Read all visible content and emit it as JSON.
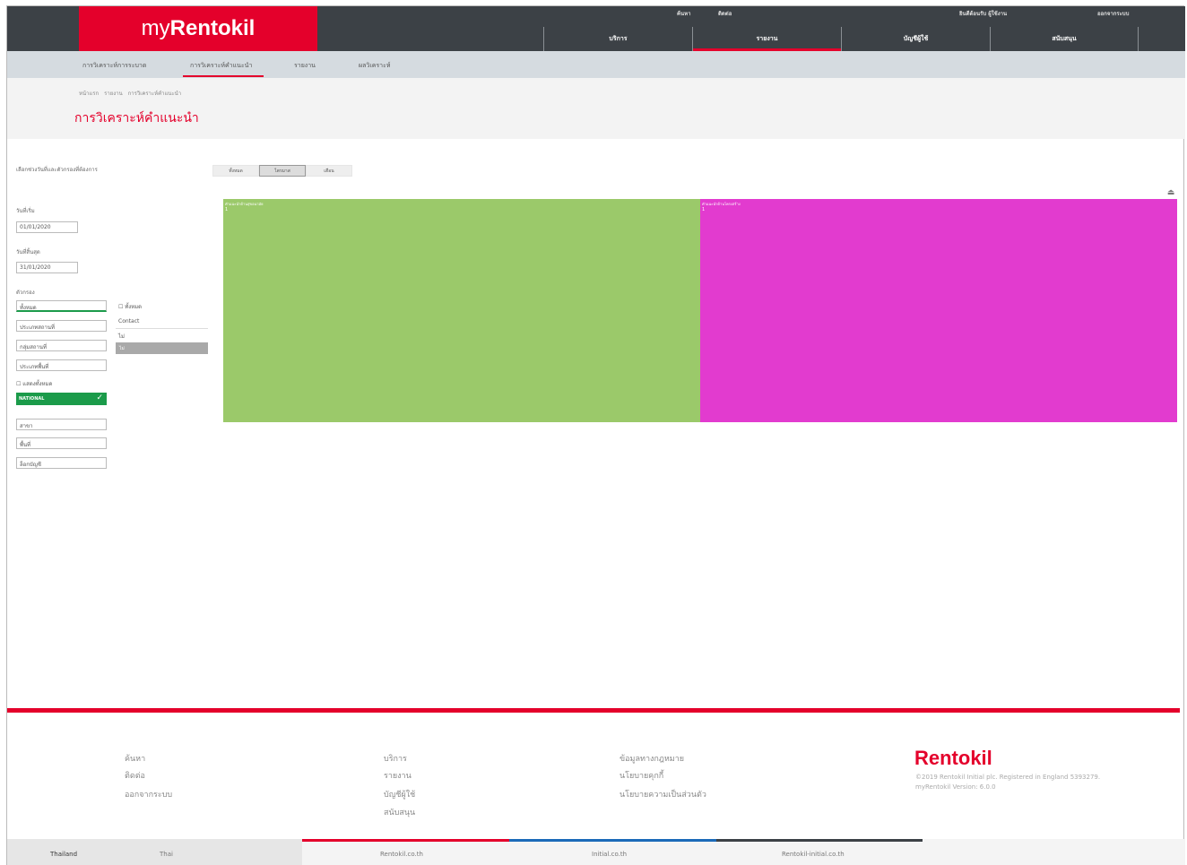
{
  "header": {
    "logo_prefix": "my",
    "logo_brand": "Rentokil",
    "top_links": [
      "ค้นหา",
      "ติดต่อ"
    ],
    "user_greeting": "ยินดีต้อนรับ ผู้ใช้งาน",
    "logout": "ออกจากระบบ",
    "nav": [
      {
        "label": "บริการ",
        "active": false
      },
      {
        "label": "รายงาน",
        "active": true
      },
      {
        "label": "บัญชีผู้ใช้",
        "active": false
      },
      {
        "label": "สนับสนุน",
        "active": false
      }
    ]
  },
  "subnav": {
    "items": [
      "การวิเคราะห์การระบาด",
      "การวิเคราะห์คำแนะนำ",
      "รายงาน",
      "ผลวิเคราะห์"
    ]
  },
  "breadcrumb": [
    "หน้าแรก",
    "รายงาน",
    "การวิเคราะห์คำแนะนำ"
  ],
  "page_title": "การวิเคราะห์คำแนะนำ",
  "filters": {
    "intro": "เลือกช่วงวันที่และตัวกรองที่ต้องการ",
    "from_label": "วันที่เริ่ม",
    "from_value": "01/01/2020",
    "to_label": "วันที่สิ้นสุด",
    "to_value": "31/01/2020",
    "location_label": "ตัวกรอง",
    "location_fields": [
      "ทั้งหมด",
      "ประเภทสถานที่",
      "กลุ่มสถานที่",
      "ประเภทพื้นที่"
    ],
    "all_checkbox": "ทั้งหมด",
    "options_list": [
      "Contact",
      "ไม่",
      "ไม่"
    ],
    "show_all_label": "แสดงทั้งหมด",
    "selected_tag": "NATIONAL",
    "extra_fields": [
      "สาขา",
      "พื้นที่",
      "ล็อกบัญชี"
    ]
  },
  "view_buttons": [
    {
      "label": "ทั้งหมด",
      "selected": false
    },
    {
      "label": "ไตรมาส",
      "selected": true
    },
    {
      "label": "เดือน",
      "selected": false
    }
  ],
  "chart_data": {
    "type": "heatmap",
    "title": "",
    "cells": [
      {
        "label": "คำแนะนำด้านสุขอนามัย",
        "value": 1,
        "color": "#9bc96a"
      },
      {
        "label": "คำแนะนำด้านโครงสร้าง",
        "value": 1,
        "color": "#e23bcf"
      }
    ]
  },
  "footer": {
    "col1": [
      "ค้นหา",
      "ติดต่อ",
      "ออกจากระบบ"
    ],
    "col2": [
      "บริการ",
      "รายงาน",
      "บัญชีผู้ใช้",
      "สนับสนุน"
    ],
    "col3": [
      "ข้อมูลทางกฎหมาย",
      "นโยบายคุกกี้",
      "นโยบายความเป็นส่วนตัว"
    ],
    "brand": "Rentokil",
    "copyright": "©2019 Rentokil Initial plc. Registered in England 5393279.",
    "version": "myRentokil Version: 6.0.0"
  },
  "bottom_bar": {
    "country": "Thailand",
    "language": "Thai",
    "sites": [
      "Rentokil.co.th",
      "Initial.co.th",
      "Rentokil-initial.co.th"
    ],
    "colors": [
      "#e4002b",
      "#1b6ab8",
      "#3c4146"
    ]
  }
}
